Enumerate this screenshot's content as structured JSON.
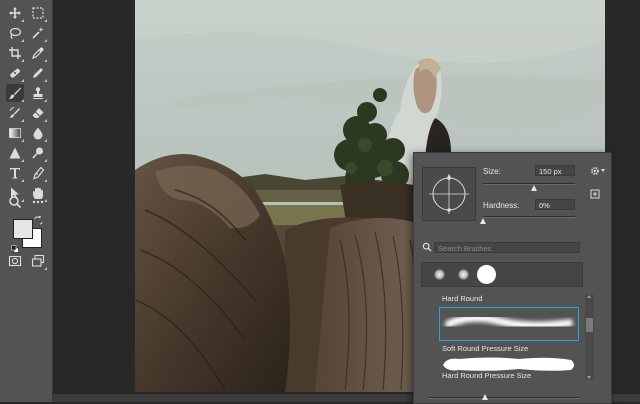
{
  "app": {
    "tools": [
      {
        "name": "move-icon",
        "icon": "move"
      },
      {
        "name": "marquee-icon",
        "icon": "marquee"
      },
      {
        "name": "lasso-icon",
        "icon": "lasso"
      },
      {
        "name": "magic-wand-icon",
        "icon": "wand"
      },
      {
        "name": "crop-icon",
        "icon": "crop"
      },
      {
        "name": "eyedropper-icon",
        "icon": "eyedropper"
      },
      {
        "name": "healing-brush-icon",
        "icon": "bandage"
      },
      {
        "name": "brush-icon",
        "icon": "brush"
      },
      {
        "name": "clone-stamp-icon",
        "icon": "stamp"
      },
      {
        "name": "history-brush-icon",
        "icon": "history"
      },
      {
        "name": "eraser-icon",
        "icon": "eraser"
      },
      {
        "name": "gradient-icon",
        "icon": "gradient"
      },
      {
        "name": "blur-icon",
        "icon": "drop"
      },
      {
        "name": "dodge-icon",
        "icon": "dodge"
      },
      {
        "name": "pen-icon",
        "icon": "pen"
      },
      {
        "name": "type-icon",
        "icon": "type"
      },
      {
        "name": "path-selection-icon",
        "icon": "arrow"
      },
      {
        "name": "hand-icon",
        "icon": "hand"
      },
      {
        "name": "zoom-icon",
        "icon": "zoom"
      },
      {
        "name": "more-tools-icon",
        "icon": "ellipsis"
      }
    ],
    "colors": {
      "foreground": "#e6e6e6",
      "background": "#ffffff",
      "accent": "#2ea0e0"
    }
  },
  "brush_panel": {
    "size_label": "Size:",
    "size_value": "150 px",
    "size_fraction": 0.55,
    "hardness_label": "Hardness:",
    "hardness_value": "0%",
    "hardness_fraction": 0.0,
    "search_placeholder": "Search Brushes",
    "brushes": [
      {
        "label": "Hard Round",
        "selected": false
      },
      {
        "label": "Soft Round Pressure Size",
        "selected": true
      },
      {
        "label": "Hard Round Pressure Size",
        "selected": false
      }
    ]
  }
}
